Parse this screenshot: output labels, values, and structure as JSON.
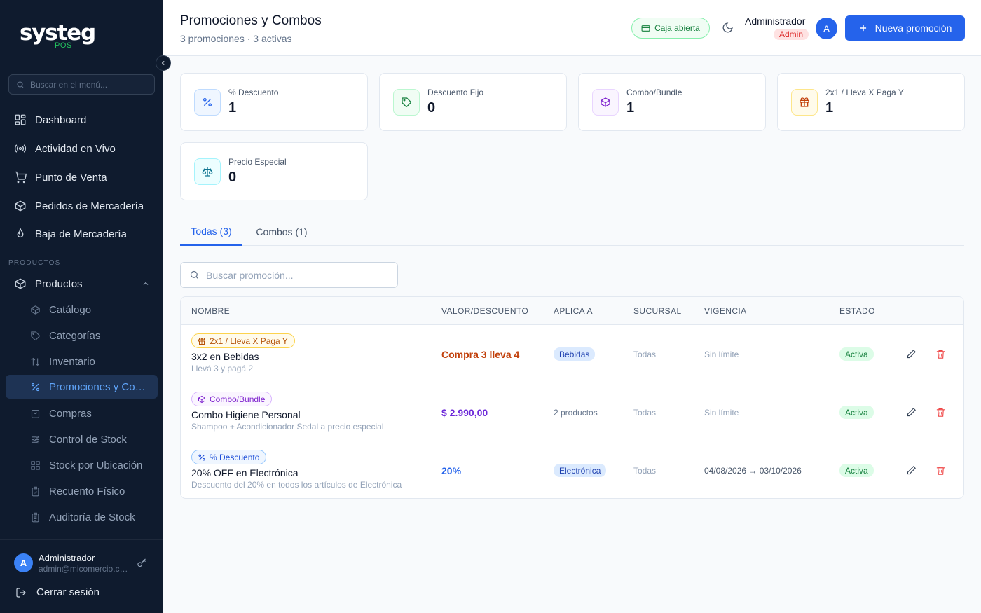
{
  "sidebar": {
    "logo": "systeg",
    "logo_sub": "POS",
    "search_placeholder": "Buscar en el menú...",
    "nav": [
      {
        "label": "Dashboard"
      },
      {
        "label": "Actividad en Vivo"
      },
      {
        "label": "Punto de Venta"
      },
      {
        "label": "Pedidos de Mercadería"
      },
      {
        "label": "Baja de Mercadería"
      }
    ],
    "section_label": "PRODUCTOS",
    "group_label": "Productos",
    "sub_items": [
      {
        "label": "Catálogo"
      },
      {
        "label": "Categorías"
      },
      {
        "label": "Inventario"
      },
      {
        "label": "Promociones y Combos"
      },
      {
        "label": "Compras"
      },
      {
        "label": "Control de Stock"
      },
      {
        "label": "Stock por Ubicación"
      },
      {
        "label": "Recuento Físico"
      },
      {
        "label": "Auditoría de Stock"
      }
    ],
    "user": {
      "initial": "A",
      "name": "Administrador",
      "email": "admin@micomercio.com"
    },
    "logout": "Cerrar sesión"
  },
  "header": {
    "title": "Promociones y Combos",
    "subtitle": "3 promociones · 3 activas",
    "caja": "Caja abierta",
    "admin_name": "Administrador",
    "admin_role": "Admin",
    "avatar_initial": "A",
    "new_button": "Nueva promoción"
  },
  "stats": [
    {
      "label": "% Descuento",
      "value": "1"
    },
    {
      "label": "Descuento Fijo",
      "value": "0"
    },
    {
      "label": "Combo/Bundle",
      "value": "1"
    },
    {
      "label": "2x1 / Lleva X Paga Y",
      "value": "1"
    },
    {
      "label": "Precio Especial",
      "value": "0"
    }
  ],
  "tabs": [
    {
      "label": "Todas (3)"
    },
    {
      "label": "Combos (1)"
    }
  ],
  "promo_search_placeholder": "Buscar promoción...",
  "table": {
    "headers": [
      "NOMBRE",
      "VALOR/DESCUENTO",
      "APLICA A",
      "SUCURSAL",
      "VIGENCIA",
      "ESTADO"
    ],
    "rows": [
      {
        "type": "2x1 / Lleva X Paga Y",
        "name": "3x2 en Bebidas",
        "desc": "Llevá 3 y pagá 2",
        "value": "Compra 3 lleva 4",
        "applies": "Bebidas",
        "branch": "Todas",
        "validity": "Sin límite",
        "status": "Activa"
      },
      {
        "type": "Combo/Bundle",
        "name": "Combo Higiene Personal",
        "desc": "Shampoo + Acondicionador Sedal a precio especial",
        "value": "$ 2.990,00",
        "applies": "2 productos",
        "branch": "Todas",
        "validity": "Sin límite",
        "status": "Activa"
      },
      {
        "type": "% Descuento",
        "name": "20% OFF en Electrónica",
        "desc": "Descuento del 20% en todos los artículos de Electrónica",
        "value": "20%",
        "applies": "Electrónica",
        "branch": "Todas",
        "validity": "04/08/2026 → 03/10/2026",
        "status": "Activa"
      }
    ]
  },
  "colors": {
    "sidebar_bg": "#0f1b2e",
    "accent": "#2563eb",
    "value_orange": "#c2410c",
    "value_purple": "#6d28d9",
    "value_blue": "#2563eb",
    "success": "#15803d",
    "danger": "#ef4444"
  }
}
